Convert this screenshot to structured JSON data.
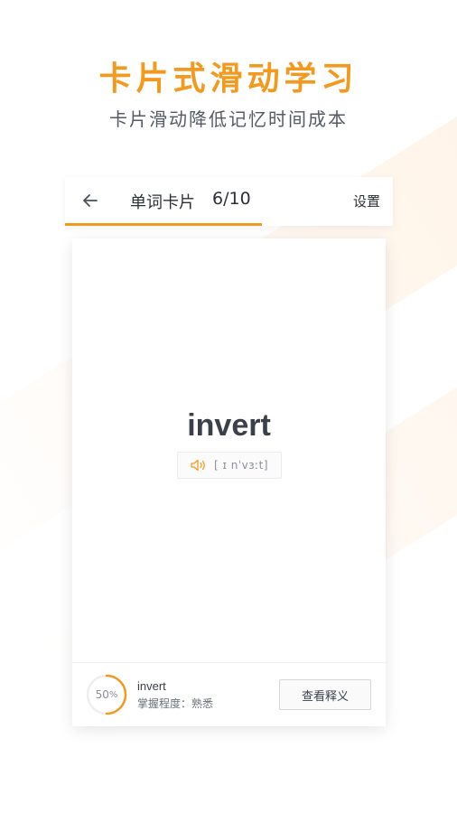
{
  "headline": "卡片式滑动学习",
  "subheadline": "卡片滑动降低记忆时间成本",
  "header": {
    "back_icon": "back-arrow-icon",
    "title": "单词卡片",
    "counter": "6/10",
    "settings_label": "设置",
    "progress_fraction": 0.6
  },
  "card": {
    "word": "invert",
    "phonetic": "[ ɪ nˈvɜːt]",
    "speaker_icon": "speaker-icon"
  },
  "footer": {
    "mastery_percent_label": "50",
    "mastery_percent_unit": "%",
    "mastery_fraction": 0.5,
    "word": "invert",
    "level_text": "掌握程度：熟悉",
    "view_button_label": "查看释义"
  },
  "colors": {
    "accent": "#f39a1e",
    "text_dark": "#2b2f36",
    "text_muted": "#8a8f98"
  }
}
